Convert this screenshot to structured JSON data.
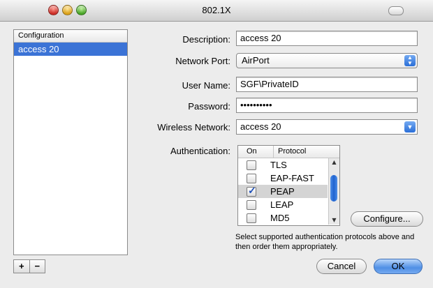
{
  "window": {
    "title": "802.1X"
  },
  "sidebar": {
    "header": "Configuration",
    "items": [
      "access 20"
    ],
    "add_label": "+",
    "remove_label": "−"
  },
  "form": {
    "description_label": "Description:",
    "description_value": "access 20",
    "network_port_label": "Network Port:",
    "network_port_value": "AirPort",
    "username_label": "User Name:",
    "username_value": "SGF\\PrivateID",
    "password_label": "Password:",
    "password_value": "••••••••••",
    "wireless_label": "Wireless Network:",
    "wireless_value": "access 20",
    "auth_label": "Authentication:",
    "auth_table": {
      "col_on": "On",
      "col_protocol": "Protocol",
      "rows": [
        {
          "name": "TLS",
          "checked": false,
          "selected": false
        },
        {
          "name": "EAP-FAST",
          "checked": false,
          "selected": false
        },
        {
          "name": "PEAP",
          "checked": true,
          "selected": true
        },
        {
          "name": "LEAP",
          "checked": false,
          "selected": false
        },
        {
          "name": "MD5",
          "checked": false,
          "selected": false
        }
      ]
    },
    "configure_label": "Configure...",
    "hint": "Select supported authentication protocols above and then order them appropriately."
  },
  "buttons": {
    "cancel": "Cancel",
    "ok": "OK"
  }
}
